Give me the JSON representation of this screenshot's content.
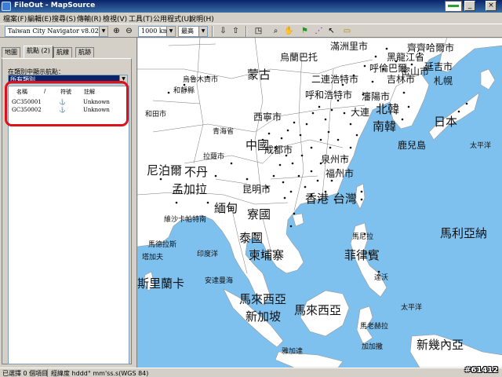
{
  "window": {
    "title": "FileOut - MapSource"
  },
  "menu": [
    "檔案(F)",
    "編輯(E)",
    "搜尋(S)",
    "傳輸(R)",
    "檢視(V)",
    "工具(T)",
    "公用程式(U)",
    "說明(H)"
  ],
  "toolbar": {
    "map_product": "Taiwan City Navigator v8.02",
    "scale": "1000 km",
    "detail": "最高"
  },
  "tabs": [
    "地圖",
    "航點 (2)",
    "航線",
    "航跡"
  ],
  "panel": {
    "show_label": "在類別中顯示航點：",
    "category": "所有類別",
    "headers": {
      "name": "名稱",
      "sort": "/",
      "symbol": "符號",
      "comment": "註解"
    },
    "waypoints": [
      {
        "name": "GC350001",
        "symbol": "⚓",
        "comment": "Unknown"
      },
      {
        "name": "GC350002",
        "symbol": "⚓",
        "comment": "Unknown"
      }
    ]
  },
  "map_labels": [
    "滿洲里市",
    "黑龍江省",
    "齊齊哈爾市",
    "呼倫巴爾",
    "烏蘭巴托",
    "蒙古",
    "烏魯木齊市",
    "和靜縣",
    "二連浩特市",
    "吉林市",
    "延吉市",
    "密山市",
    "札幌",
    "呼和浩特市",
    "瀋陽市",
    "大連",
    "和田市",
    "北韓",
    "南韓",
    "日本",
    "西寧市",
    "青海省",
    "中國",
    "鹿兒島",
    "太平洋",
    "成都市",
    "拉薩市",
    "泉州市",
    "福州市",
    "尼泊爾",
    "不丹",
    "孟加拉",
    "昆明市",
    "香港",
    "台灣",
    "緬甸",
    "寮國",
    "維沙卡帕特南",
    "馬尼拉",
    "馬利亞納",
    "馬德拉斯",
    "塔加夫",
    "印度洋",
    "泰國",
    "柬埔寨",
    "菲律賓",
    "斯里蘭卡",
    "安達曼海",
    "達沃",
    "馬來西亞",
    "太平洋",
    "新加坡",
    "馬來西亞",
    "馬老赫拉",
    "加加撒",
    "雅加達",
    "新幾內亞"
  ],
  "status": {
    "selected": "已選擇 0 個項目",
    "coords": "經緯度 hddd° mm'ss.s(WGS 84)"
  },
  "watermark": "#61412",
  "colors": {
    "sea": "#7ec0ee",
    "land": "#ffffff",
    "selection": "#0a246a",
    "highlight": "#e0101a"
  }
}
